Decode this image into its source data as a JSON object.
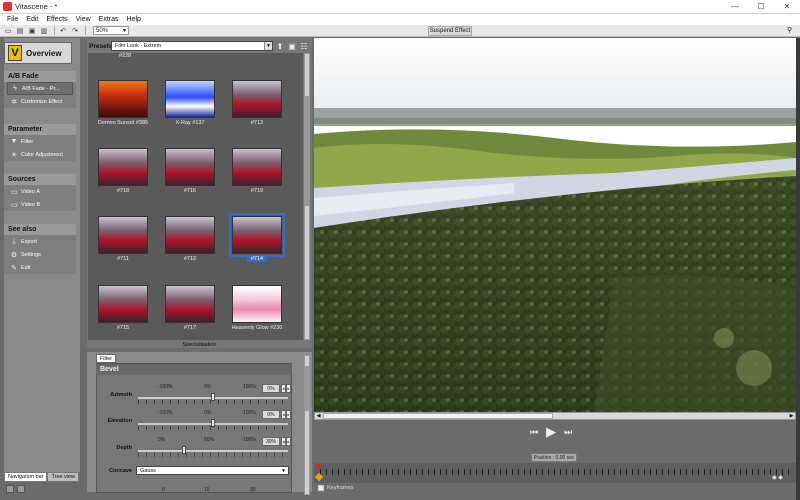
{
  "window": {
    "title": "Vitascene - *",
    "min": "—",
    "max": "☐",
    "close": "✕"
  },
  "menu": [
    "File",
    "Edit",
    "Effects",
    "View",
    "Extras",
    "Help"
  ],
  "toolbar": {
    "zoom": "50%",
    "suspend_label": "Suspend Effect"
  },
  "nav": {
    "overview": "Overview",
    "sections": [
      {
        "title": "A/B Fade",
        "items": [
          {
            "label": "A/B Fade - Pr...",
            "icon": "lightning-icon"
          },
          {
            "label": "Customize Effect",
            "icon": "gear-icon"
          }
        ]
      },
      {
        "title": "Parameter",
        "items": [
          {
            "label": "Filter",
            "icon": "filter-icon"
          },
          {
            "label": "Color Adjustment",
            "icon": "sun-icon"
          }
        ]
      },
      {
        "title": "Sources",
        "items": [
          {
            "label": "Video A",
            "icon": "monitor-icon"
          },
          {
            "label": "Video B",
            "icon": "monitor-icon"
          }
        ]
      },
      {
        "title": "See also",
        "items": [
          {
            "label": "Export",
            "icon": "export-icon"
          },
          {
            "label": "Settings",
            "icon": "settings-icon"
          },
          {
            "label": "Edit",
            "icon": "edit-icon"
          }
        ]
      }
    ],
    "bottom_tabs": [
      "Navigation bar",
      "Tree view"
    ]
  },
  "presets": {
    "label": "Presets",
    "selected": "Film Look - Extrem",
    "top_row_labels": [
      "#228",
      "",
      ""
    ],
    "thumbs": [
      {
        "label": "Demon Sunset #385",
        "style": "demon"
      },
      {
        "label": "X-Ray #137",
        "style": "xray"
      },
      {
        "label": "#713",
        "style": "normal"
      },
      {
        "label": "#718",
        "style": "normal"
      },
      {
        "label": "#716",
        "style": "normal"
      },
      {
        "label": "#719",
        "style": "normal"
      },
      {
        "label": "#711",
        "style": "normal"
      },
      {
        "label": "#712",
        "style": "normal"
      },
      {
        "label": "#714",
        "style": "normal",
        "selected": true
      },
      {
        "label": "#715",
        "style": "normal"
      },
      {
        "label": "#717",
        "style": "normal"
      },
      {
        "label": "Heavenly Glow #230",
        "style": "glow"
      }
    ],
    "specialisation": "Specialisation"
  },
  "filter": {
    "tab": "Filter",
    "group": "Bevel",
    "params": [
      {
        "name": "Azimuth",
        "scale": [
          "-100%",
          "0%",
          "100%"
        ],
        "value": "0%",
        "knob": 0.5
      },
      {
        "name": "Elevation",
        "scale": [
          "-100%",
          "0%",
          "100%"
        ],
        "value": "0%",
        "knob": 0.5
      },
      {
        "name": "Depth",
        "scale": [
          "0%",
          "50%",
          "100%"
        ],
        "value": "30%",
        "knob": 0.3
      }
    ],
    "concave": {
      "name": "Concave",
      "value": "Gauss"
    },
    "bottom_scale": [
      "0",
      "15",
      "30"
    ]
  },
  "player": {
    "position": "Position : 0.00 sec",
    "keyframes": "Keyframes"
  }
}
